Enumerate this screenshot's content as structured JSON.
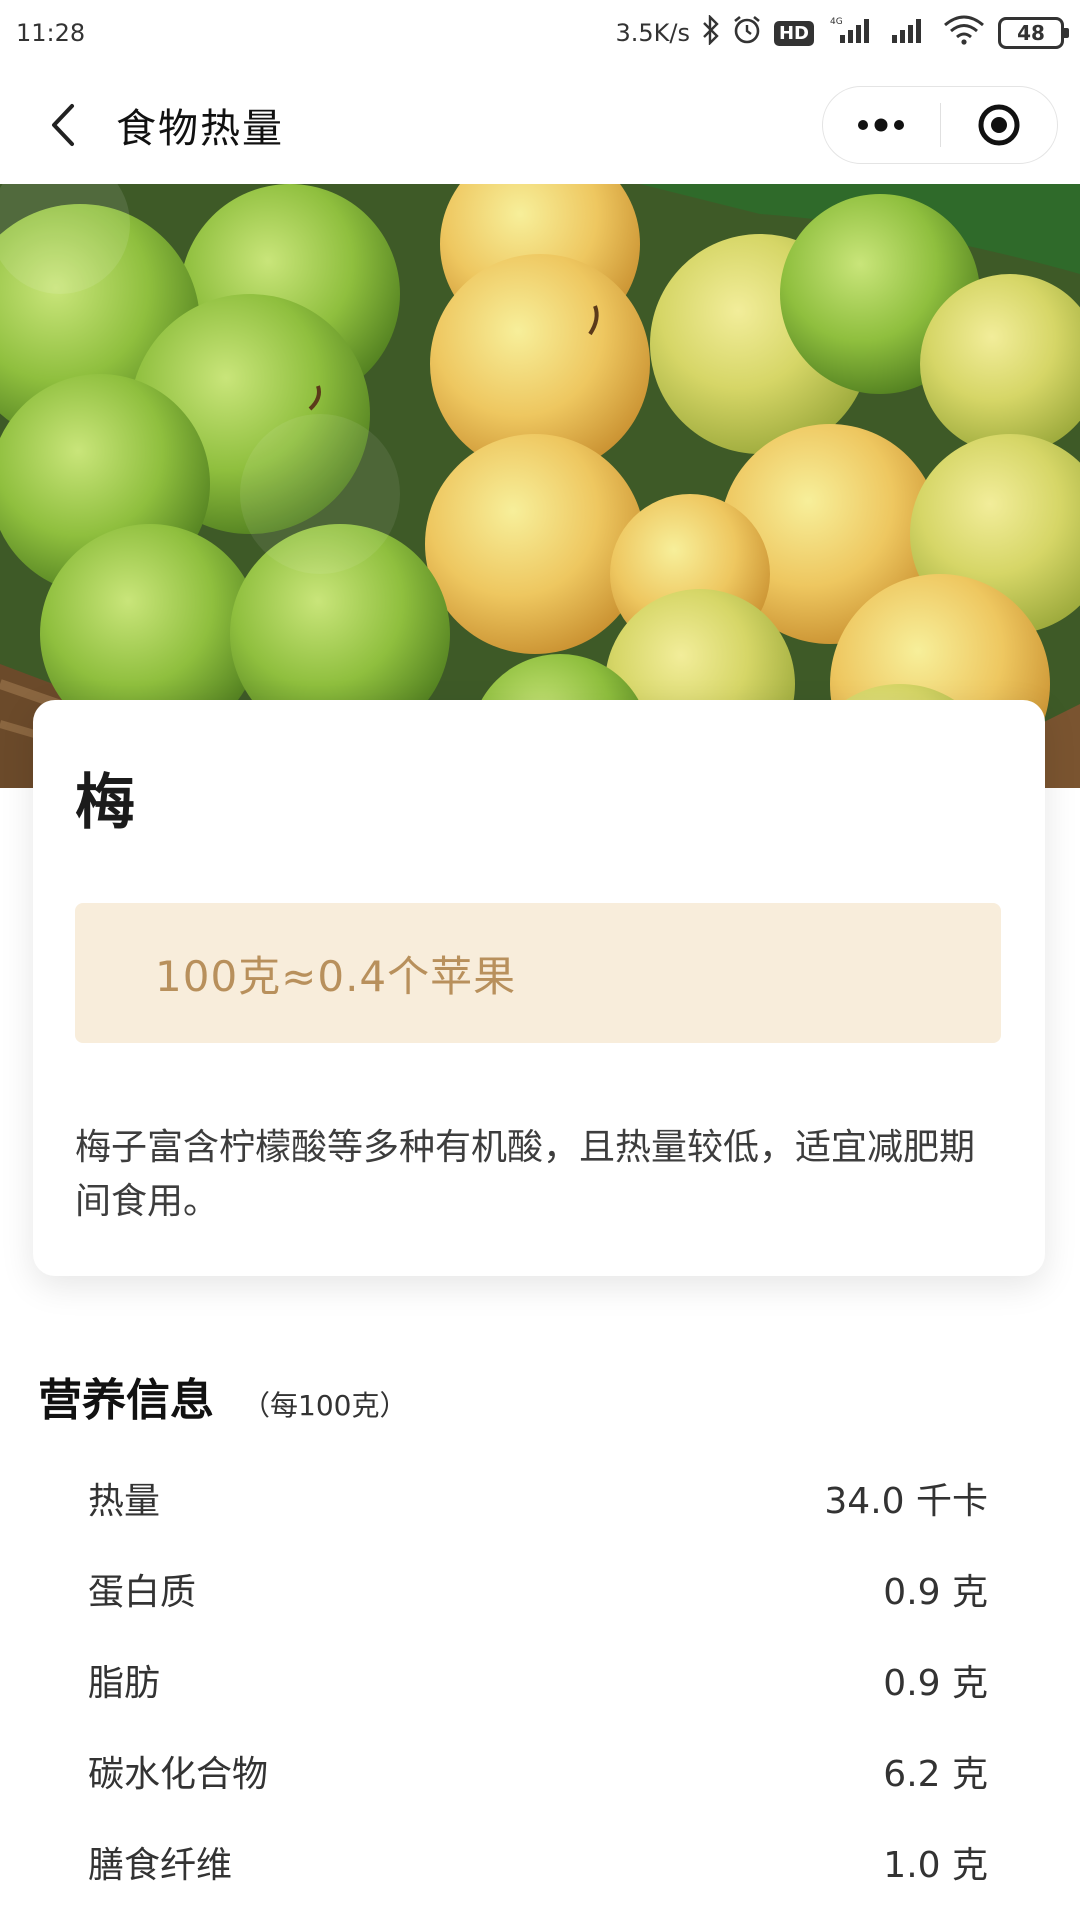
{
  "status_bar": {
    "time": "11:28",
    "net_speed": "3.5K/s",
    "hd_label": "HD",
    "network_type": "4G",
    "battery_level": "48"
  },
  "nav": {
    "title": "食物热量"
  },
  "colors": {
    "accent_box_bg": "#f8eddb",
    "accent_box_text": "#b8905c"
  },
  "food": {
    "name": "梅",
    "equivalence": "100克≈0.4个苹果",
    "description": "梅子富含柠檬酸等多种有机酸，且热量较低，适宜减肥期间食用。"
  },
  "nutrition": {
    "title": "营养信息",
    "unit_note": "（每100克）",
    "items": [
      {
        "label": "热量",
        "value": "34.0 千卡"
      },
      {
        "label": "蛋白质",
        "value": "0.9 克"
      },
      {
        "label": "脂肪",
        "value": "0.9 克"
      },
      {
        "label": "碳水化合物",
        "value": "6.2 克"
      },
      {
        "label": "膳食纤维",
        "value": "1.0 克"
      }
    ]
  }
}
